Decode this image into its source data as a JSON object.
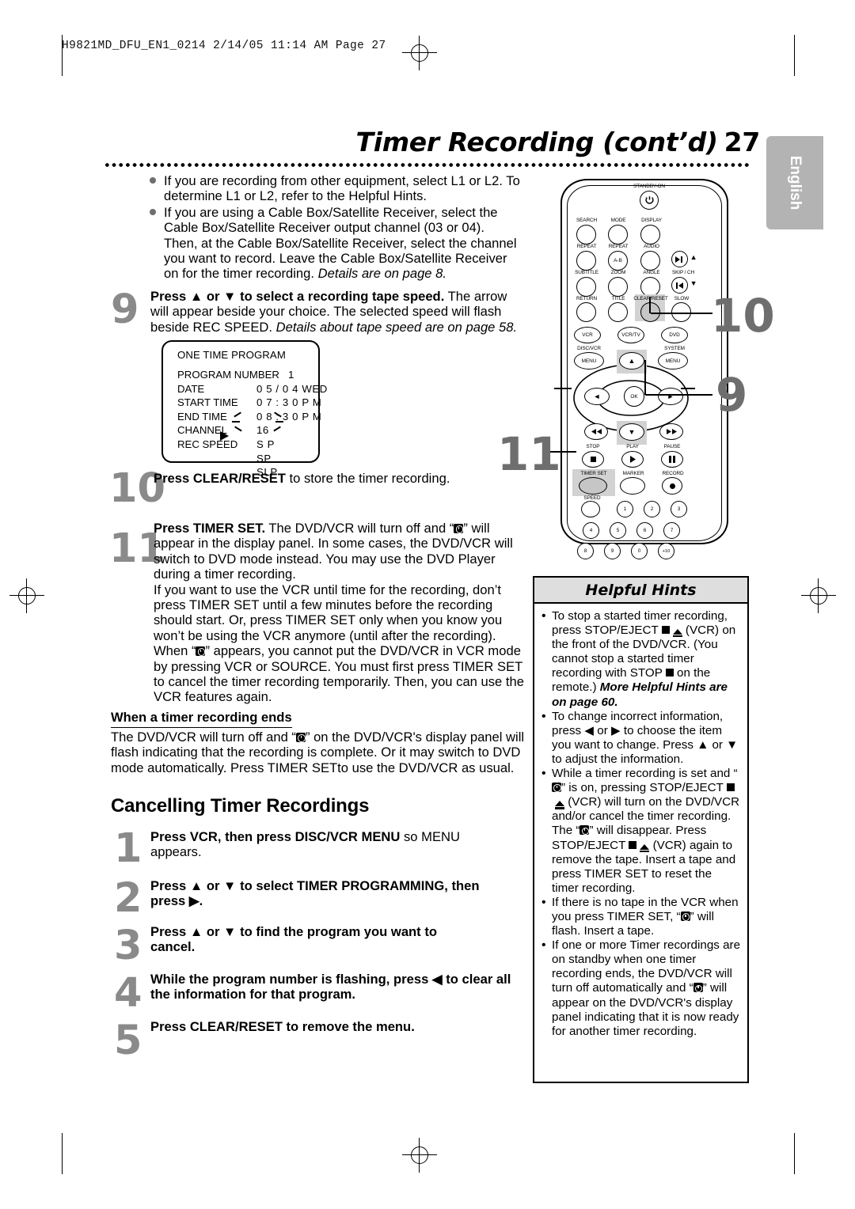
{
  "slug": "H9821MD_DFU_EN1_0214   2/14/05  11:14 AM  Page 27",
  "title": {
    "text": "Timer Recording (cont’d)",
    "page": "27"
  },
  "lang_tab": "English",
  "bullets": [
    "If you are recording from other equipment, select L1 or L2. To determine L1 or L2, refer to the Helpful Hints.",
    "If you are using a Cable Box/Satellite Receiver, select the Cable Box/Satellite Receiver output channel (03 or 04). Then, at the Cable Box/Satellite Receiver, select the channel you want to record. Leave the Cable Box/Satellite Receiver on for the timer recording."
  ],
  "bullet2_italic": "Details are on page 8.",
  "step9": {
    "num": "9",
    "bold": "Press ▲ or ▼ to select a recording tape speed.",
    "rest": " The arrow will appear beside your choice. The selected speed will flash beside REC SPEED. ",
    "italic": "Details about tape speed are on page 58."
  },
  "osd": {
    "title": "ONE TIME PROGRAM",
    "rows": [
      {
        "label": "PROGRAM NUMBER",
        "value": "1",
        "numeric": true
      },
      {
        "label": "DATE",
        "value": "0 5 / 0 4  WED",
        "numeric": false
      },
      {
        "label": "START TIME",
        "value": "0 7 : 3 0  P M",
        "numeric": false
      },
      {
        "label": "END   TIME",
        "value": "0 8 : 3 0  P M",
        "numeric": false
      },
      {
        "label": "CHANNEL",
        "value": "16",
        "numeric": false
      },
      {
        "label": "REC SPEED",
        "value": "S P",
        "numeric": false
      }
    ],
    "speed_options": [
      "SP",
      "SLP"
    ]
  },
  "step10": {
    "num": "10",
    "bold": "Press CLEAR/RESET",
    "rest": " to store the timer recording."
  },
  "step11": {
    "num": "11",
    "bold": "Press TIMER SET.",
    "para1_a": " The DVD/VCR will turn off and “",
    "para1_b": "” will appear in the display panel. In some cases, the DVD/VCR will switch to DVD mode instead. You may use the DVD Player during a timer recording.",
    "para2_a": "If you want to use the VCR until time for the recording, don’t press TIMER SET until a few minutes before the recording should start. Or, press TIMER SET only when you know you won’t be using the VCR anymore (until after the recording). When “",
    "para2_b": "” appears, you cannot put the DVD/VCR in VCR mode by pressing VCR or SOURCE. You must first press TIMER SET to cancel the timer recording temporarily. Then, you can use the VCR features again."
  },
  "when_ends": {
    "heading": "When a timer recording ends",
    "text_a": "The DVD/VCR will turn off and “",
    "text_b": "” on the DVD/VCR's display panel will flash indicating that the recording is complete. Or it may switch to DVD mode automatically. Press TIMER SETto use the DVD/VCR as usual."
  },
  "cancelling": {
    "heading": "Cancelling Timer Recordings",
    "steps": [
      {
        "num": "1",
        "bold": "Press VCR, then press DISC/VCR MENU",
        "rest": " so MENU appears."
      },
      {
        "num": "2",
        "bold": "Press ▲ or ▼ to select TIMER PROGRAMMING, then press ▶.",
        "rest": ""
      },
      {
        "num": "3",
        "bold": "Press ▲ or ▼ to find the program you want to cancel.",
        "rest": ""
      },
      {
        "num": "4",
        "bold": "While the program number is flashing, press ◀ to clear all the information for that program.",
        "rest": ""
      },
      {
        "num": "5",
        "bold": "Press CLEAR/RESET to remove the menu.",
        "rest": ""
      }
    ]
  },
  "hints": {
    "title": "Helpful Hints",
    "items": [
      {
        "segments": [
          {
            "t": "text",
            "v": "To stop a started timer recording, press STOP/EJECT "
          },
          {
            "t": "icon",
            "v": "stop-square-icon"
          },
          {
            "t": "icon",
            "v": "eject-triangle-icon"
          },
          {
            "t": "text",
            "v": " (VCR) on the front of the DVD/VCR. (You cannot stop a started timer recording with STOP "
          },
          {
            "t": "icon",
            "v": "stop-square-icon"
          },
          {
            "t": "text",
            "v": " on the remote.) "
          },
          {
            "t": "bolditalic",
            "v": "More Helpful Hints are on page 60."
          }
        ]
      },
      {
        "segments": [
          {
            "t": "text",
            "v": "To change incorrect information, press ◀ or ▶ to choose the item you want to change. Press ▲ or ▼ to adjust the information."
          }
        ]
      },
      {
        "segments": [
          {
            "t": "text",
            "v": "While a timer recording is set and “"
          },
          {
            "t": "icon",
            "v": "timer-icon"
          },
          {
            "t": "text",
            "v": "” is on, pressing STOP/EJECT "
          },
          {
            "t": "icon",
            "v": "stop-square-icon"
          },
          {
            "t": "icon",
            "v": "eject-triangle-icon"
          },
          {
            "t": "text",
            "v": " (VCR) will turn on the DVD/VCR and/or cancel the timer recording. The “"
          },
          {
            "t": "icon",
            "v": "timer-icon"
          },
          {
            "t": "text",
            "v": "” will disappear. Press STOP/EJECT "
          },
          {
            "t": "icon",
            "v": "stop-square-icon"
          },
          {
            "t": "icon",
            "v": "eject-triangle-icon"
          },
          {
            "t": "text",
            "v": " (VCR) again to remove the tape. Insert a tape and press TIMER SET to reset the timer recording."
          }
        ]
      },
      {
        "segments": [
          {
            "t": "text",
            "v": "If there is no tape in the VCR when you press TIMER SET, “"
          },
          {
            "t": "icon",
            "v": "timer-icon"
          },
          {
            "t": "text",
            "v": "” will flash. Insert a tape."
          }
        ]
      },
      {
        "segments": [
          {
            "t": "text",
            "v": "If one or more Timer recordings are on standby when one timer recording ends, the DVD/VCR will turn off automatically and “"
          },
          {
            "t": "icon",
            "v": "timer-icon"
          },
          {
            "t": "text",
            "v": "” will appear on the DVD/VCR's display panel indicating that it is now ready for another timer recording."
          }
        ]
      }
    ]
  },
  "remote": {
    "standby_label": "STANDBY-ON",
    "power_icon": "power-icon",
    "row_labels_1": [
      "SEARCH",
      "MODE",
      "DISPLAY"
    ],
    "row_labels_2": [
      "REPEAT",
      "REPEAT",
      "AUDIO"
    ],
    "row2_mid_text": "A-B",
    "row_labels_3": [
      "SUBTITLE",
      "ZOOM",
      "ANGLE",
      "SKIP / CH"
    ],
    "row_labels_4": [
      "RETURN",
      "TITLE",
      "CLEAR/RESET",
      "SLOW"
    ],
    "source_buttons": [
      "VCR",
      "VCR/TV",
      "DVD"
    ],
    "menu_labels": [
      "DISC/VCR",
      "SYSTEM"
    ],
    "menu_button_text": "MENU",
    "ok_text": "OK",
    "transport_labels": [
      "STOP",
      "PLAY",
      "PAUSE"
    ],
    "timer_row_labels": [
      "TIMER SET",
      "MARKER",
      "RECORD"
    ],
    "speed_label": "SPEED",
    "keypad": [
      "1",
      "2",
      "3",
      "4",
      "5",
      "6",
      "7",
      "8",
      "9",
      "0",
      "+10"
    ],
    "callouts": [
      "10",
      "9",
      "11"
    ]
  },
  "colors": {
    "step_number_grey": "#8a8a8a",
    "lang_tab_grey": "#b3b3b3",
    "hint_header_grey": "#dedede",
    "highlight_grey": "#d2d2d2"
  }
}
